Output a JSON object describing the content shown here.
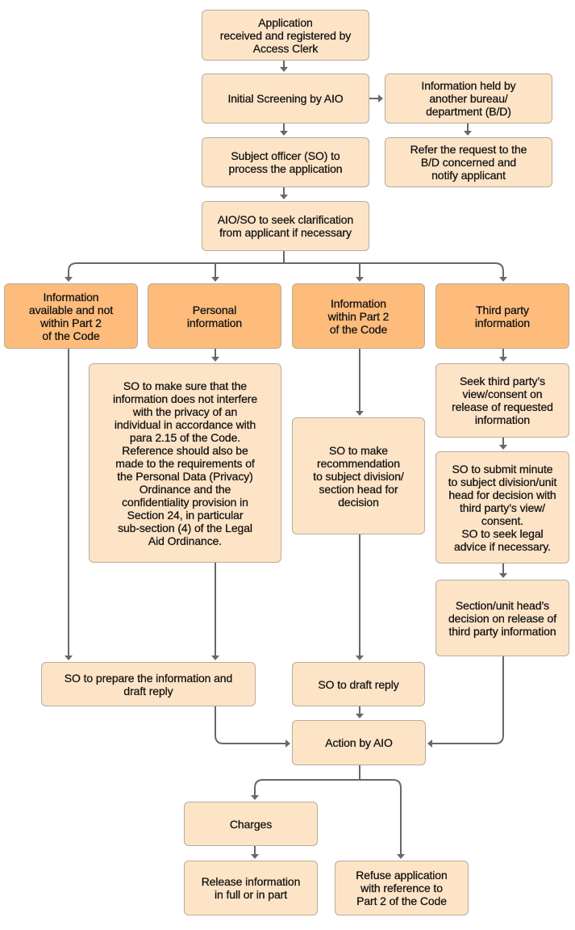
{
  "colors": {
    "box_fill": "#fde4c7",
    "category_fill": "#fdbc7c",
    "border": "#b9ab9c",
    "connector": "#686868"
  },
  "nodes": {
    "application": "Application\nreceived and registered by\nAccess Clerk",
    "initial_screening": "Initial Screening by AIO",
    "held_by_other": "Information held by\nanother bureau/\ndepartment (B/D)",
    "so_process": "Subject officer (SO) to\nprocess the application",
    "refer_request": "Refer the request to the\nB/D concerned and\nnotify applicant",
    "seek_clarification": "AIO/SO to seek clarification\nfrom applicant if necessary",
    "cat_available": "Information\navailable and not\nwithin Part 2\nof the Code",
    "cat_personal": "Personal\ninformation",
    "cat_part2": "Information\nwithin Part 2\nof the Code",
    "cat_third_party": "Third party\ninformation",
    "privacy_check": "SO to make sure that the\ninformation does not interfere\nwith the privacy of an\nindividual in accordance with\npara 2.15 of the Code.\nReference should also be\nmade to the requirements of\nthe Personal Data (Privacy)\nOrdinance and the\nconfidentiality provision in\nSection 24, in particular\nsub-section (4) of the Legal\nAid Ordinance.",
    "recommendation": "SO to make\nrecommendation\nto subject division/\nsection head for\ndecision",
    "seek_third_party": "Seek third party’s\nview/consent on\nrelease of requested\ninformation",
    "submit_minute": "SO to submit minute\nto subject division/unit\nhead for decision with\nthird party’s view/\nconsent.\nSO to seek legal\nadvice if necessary.",
    "head_decision": "Section/unit head’s\ndecision on release of\nthird party information",
    "prepare_reply": "SO to prepare the information and\ndraft reply",
    "draft_reply": "SO to draft reply",
    "action_aio": "Action by AIO",
    "charges": "Charges",
    "release": "Release information\nin full or in part",
    "refuse": "Refuse application\nwith reference to\nPart 2 of the Code"
  }
}
